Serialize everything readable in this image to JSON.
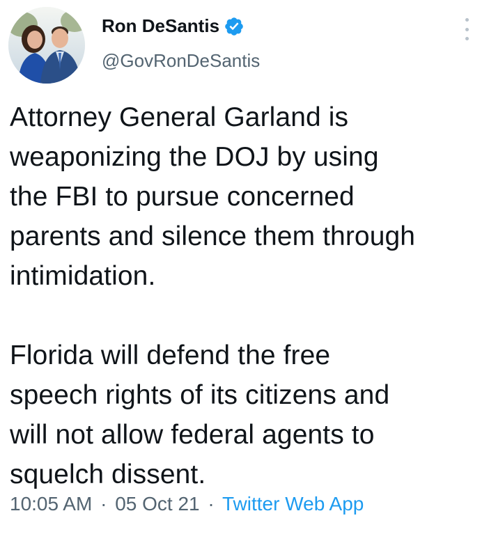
{
  "author": {
    "display_name": "Ron DeSantis",
    "handle": "@GovRonDeSantis",
    "verified_icon": "verified-badge-icon",
    "more_icon": "more-options-icon"
  },
  "tweet": {
    "paragraphs": [
      "Attorney General Garland is\nweaponizing the DOJ by using\nthe FBI to pursue concerned\nparents and silence them through\nintimidation.",
      "Florida will defend the free\nspeech rights of its citizens and\nwill not allow federal agents to\nsquelch dissent."
    ]
  },
  "meta": {
    "time": "10:05 AM",
    "separator": "·",
    "date": "05 Oct 21",
    "source": "Twitter Web App"
  },
  "colors": {
    "text_primary": "#0f1419",
    "text_secondary": "#536471",
    "link_blue": "#1d9bf0",
    "verified_blue": "#1d9bf0"
  }
}
